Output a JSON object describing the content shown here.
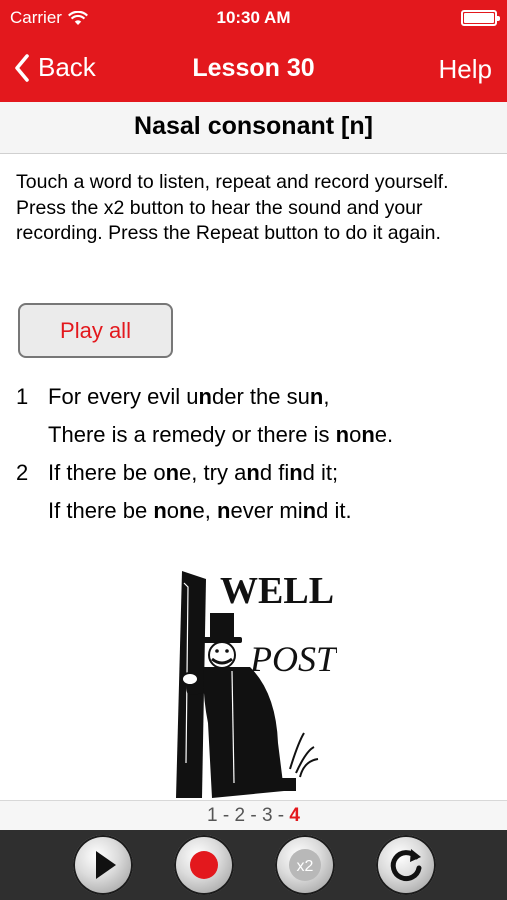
{
  "status": {
    "carrier": "Carrier",
    "time": "10:30 AM"
  },
  "nav": {
    "back": "Back",
    "title": "Lesson 30",
    "help": "Help"
  },
  "header": {
    "title": "Nasal consonant [n]"
  },
  "instructions": "Touch a word to listen, repeat and record yourself. Press the x2 button to hear the sound and your recording. Press the Repeat button to do it again.",
  "play_all": "Play all",
  "phrases": [
    {
      "num": "1",
      "lines": [
        [
          "For",
          " ",
          "every",
          " ",
          "evil",
          " ",
          "under",
          " ",
          "the",
          " ",
          "sun,"
        ],
        [
          "There",
          " ",
          "is",
          " ",
          "a",
          " ",
          "remedy",
          " ",
          "or",
          " ",
          "there",
          " ",
          "is",
          " ",
          "none."
        ]
      ]
    },
    {
      "num": "2",
      "lines": [
        [
          "If",
          " ",
          "there",
          " ",
          "be",
          " ",
          "one,",
          " ",
          "try",
          " ",
          "and",
          " ",
          "find",
          " ",
          "it;"
        ],
        [
          "If",
          " ",
          "there",
          " ",
          "be",
          " ",
          "none,",
          " ",
          "never",
          " ",
          "mind",
          " ",
          "it."
        ]
      ]
    }
  ],
  "illustration": {
    "text_line1": "WELL",
    "text_line2": "POST"
  },
  "pager": {
    "pages": [
      "1",
      "2",
      "3"
    ],
    "current": "4"
  },
  "controls": {
    "icons": [
      "play-icon",
      "record-icon",
      "x2-icon",
      "repeat-icon"
    ],
    "x2_label": "x2"
  },
  "colors": {
    "brand_red": "#e3181d",
    "controls_bg": "#2f2f2f"
  }
}
